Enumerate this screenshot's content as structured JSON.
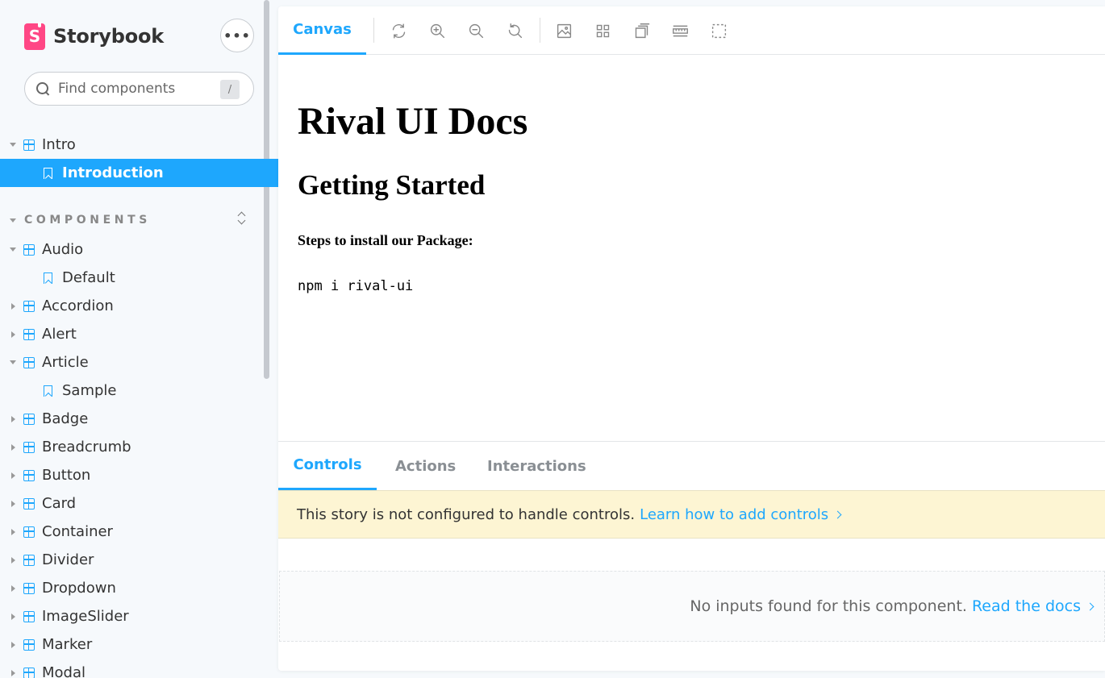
{
  "app": {
    "name": "Storybook",
    "logo_letter": "S",
    "menu_glyph": "•••"
  },
  "search": {
    "placeholder": "Find components",
    "shortcut": "/"
  },
  "sidebar": {
    "intro_group": {
      "label": "Intro",
      "story": "Introduction"
    },
    "section_label": "COMPONENTS",
    "components": [
      {
        "label": "Audio",
        "expanded": true,
        "stories": [
          "Default"
        ]
      },
      {
        "label": "Accordion"
      },
      {
        "label": "Alert"
      },
      {
        "label": "Article",
        "expanded": true,
        "stories": [
          "Sample"
        ]
      },
      {
        "label": "Badge"
      },
      {
        "label": "Breadcrumb"
      },
      {
        "label": "Button"
      },
      {
        "label": "Card"
      },
      {
        "label": "Container"
      },
      {
        "label": "Divider"
      },
      {
        "label": "Dropdown"
      },
      {
        "label": "ImageSlider"
      },
      {
        "label": "Marker"
      },
      {
        "label": "Modal"
      }
    ]
  },
  "toolbar": {
    "canvas_tab": "Canvas",
    "tools": [
      "reload-icon",
      "zoom-in-icon",
      "zoom-out-icon",
      "zoom-reset-icon",
      "background-icon",
      "grid-icon",
      "viewport-icon",
      "measure-icon",
      "outline-icon"
    ]
  },
  "doc": {
    "title": "Rival UI Docs",
    "subtitle": "Getting Started",
    "steps_label": "Steps to install our Package:",
    "install_cmd": "npm i rival-ui"
  },
  "addons": {
    "tabs": [
      "Controls",
      "Actions",
      "Interactions"
    ],
    "notice_text": "This story is not configured to handle controls.",
    "notice_link": "Learn how to add controls",
    "empty_text": "No inputs found for this component.",
    "empty_link": "Read the docs"
  },
  "colors": {
    "accent": "#1ea7fd",
    "brand": "#ff4785",
    "notice_bg": "#fdf5d3"
  }
}
